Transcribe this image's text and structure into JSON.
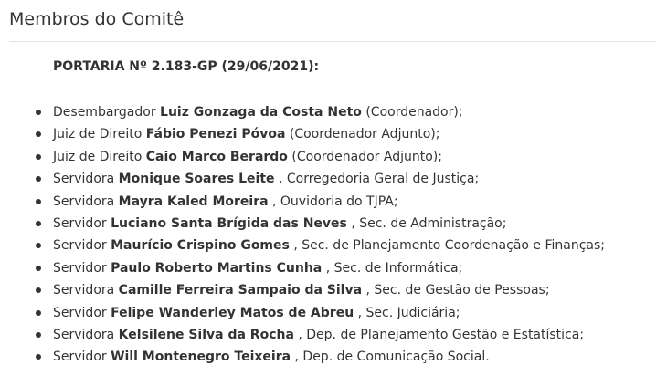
{
  "section": {
    "title": "Membros do Comitê",
    "ordinance": "PORTARIA Nº 2.183-GP (29/06/2021):"
  },
  "members": [
    {
      "title": "Desembargador",
      "name": "Luiz Gonzaga da Costa Neto",
      "role": "(Coordenador);"
    },
    {
      "title": "Juiz de Direito",
      "name": "Fábio Penezi Póvoa",
      "role": "(Coordenador Adjunto);"
    },
    {
      "title": "Juiz de Direito",
      "name": "Caio Marco Berardo",
      "role": "(Coordenador Adjunto);"
    },
    {
      "title": "Servidora",
      "name": "Monique Soares Leite",
      "role": ", Corregedoria Geral de Justiça;"
    },
    {
      "title": "Servidora",
      "name": "Mayra Kaled Moreira",
      "role": ", Ouvidoria do TJPA;"
    },
    {
      "title": "Servidor",
      "name": "Luciano Santa Brígida das Neves",
      "role": ", Sec. de Administração;"
    },
    {
      "title": "Servidor",
      "name": "Maurício Crispino Gomes",
      "role": ", Sec. de Planejamento Coordenação e Finanças;"
    },
    {
      "title": "Servidor",
      "name": "Paulo Roberto Martins Cunha",
      "role": ", Sec. de Informática;"
    },
    {
      "title": "Servidora",
      "name": "Camille Ferreira Sampaio da Silva",
      "role": ", Sec. de Gestão de Pessoas;"
    },
    {
      "title": "Servidor",
      "name": "Felipe Wanderley Matos de Abreu",
      "role": ", Sec. Judiciária;"
    },
    {
      "title": "Servidora",
      "name": "Kelsilene Silva da Rocha",
      "role": ", Dep. de Planejamento Gestão e Estatística;"
    },
    {
      "title": "Servidor",
      "name": "Will Montenegro Teixeira",
      "role": ", Dep. de Comunicação Social."
    }
  ]
}
